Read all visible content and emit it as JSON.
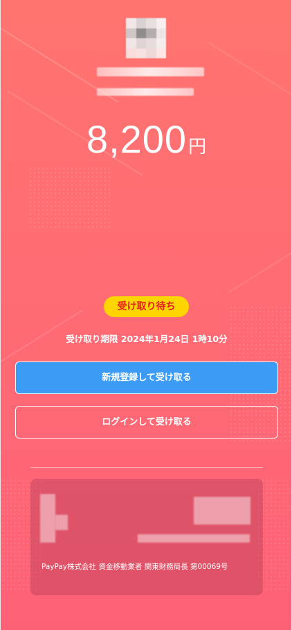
{
  "amount": {
    "value": "8,200",
    "unit": "円"
  },
  "status_badge": "受け取り待ち",
  "deadline": {
    "label": "受け取り期限",
    "datetime": "2024年1月24日 1時10分"
  },
  "buttons": {
    "register": "新規登録して受け取る",
    "login": "ログインして受け取る"
  },
  "footer": "PayPay株式会社 資金移動業者 関東財務局長 第00069号",
  "colors": {
    "badge": "#ffd500",
    "badge_text": "#e2221f",
    "register_button": "#3c9bf5"
  }
}
